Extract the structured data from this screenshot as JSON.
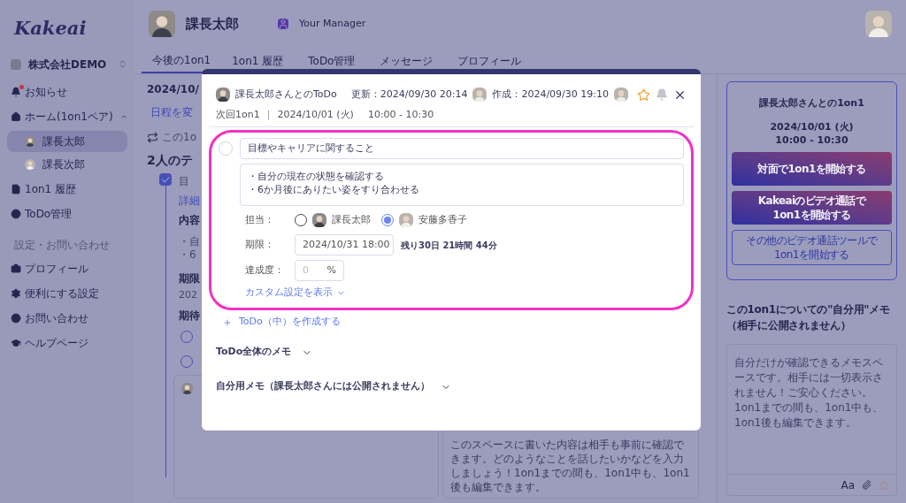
{
  "app": {
    "logo": "Kakeai",
    "company": "株式会社DEMO"
  },
  "sidebar": {
    "items": [
      {
        "kind": "link",
        "label": "お知らせ",
        "unread": true
      },
      {
        "kind": "group",
        "label": "ホーム(1on1ペア)",
        "expanded": true,
        "children": [
          {
            "label": "課長太郎",
            "selected": true
          },
          {
            "label": "課長次郎",
            "selected": false
          }
        ]
      },
      {
        "kind": "link",
        "label": "1on1 履歴",
        "unread": false
      },
      {
        "kind": "link",
        "label": "ToDo管理",
        "unread": false
      },
      {
        "kind": "heading",
        "label": "設定・お問い合わせ"
      },
      {
        "kind": "link",
        "label": "プロフィール",
        "unread": false
      },
      {
        "kind": "link",
        "label": "便利にする設定",
        "unread": false
      },
      {
        "kind": "link",
        "label": "お問い合わせ",
        "unread": false
      },
      {
        "kind": "link",
        "label": "ヘルプページ",
        "unread": false
      }
    ]
  },
  "header": {
    "name": "課長太郎",
    "role": "Your Manager"
  },
  "tabs": [
    {
      "label": "今後の1on1",
      "selected": true
    },
    {
      "label": "1on1 履歴",
      "selected": false
    },
    {
      "label": "ToDo管理",
      "selected": false
    },
    {
      "label": "メッセージ",
      "selected": false
    },
    {
      "label": "プロフィール",
      "selected": false
    }
  ],
  "main": {
    "date": "2024/10/",
    "reschedule": "日程を変",
    "repeat": "この1o",
    "themes_heading": "2人のテ",
    "theme": {
      "checked": true,
      "title": "目",
      "detail_link": "詳細",
      "content_label": "内容",
      "lines": [
        "・自",
        "・6"
      ],
      "due_label": "期限",
      "due": "202",
      "expect_label": "期待"
    },
    "shared_memo_hint": "このスペースに書いた内容は相手も事前に確認できます。どのようなことを話したいかなどを入力しましょう！1on1までの間も、1on1中も、1on1後も編集できます。"
  },
  "right_panel": {
    "title": "課長太郎さんとの1on1",
    "date": "2024/10/01 (火)",
    "time": "10:00 - 10:30",
    "buttons": [
      {
        "kind": "primary",
        "lines": [
          "対面で1on1を開始する"
        ]
      },
      {
        "kind": "primary",
        "lines": [
          "Kakeaiのビデオ通話で",
          "1on1を開始する"
        ]
      },
      {
        "kind": "outline",
        "lines": [
          "その他のビデオ通話ツールで",
          "1on1を開始する"
        ]
      }
    ],
    "memo_heading": [
      "この1on1についての\"自分用\"メモ",
      "（相手に公開されません）"
    ],
    "memo_placeholder": "自分だけが確認できるメモスペースです。相手には一切表示されません！ご安心ください。1on1までの間も、1on1中も、1on1後も編集できます。",
    "format_label": "Aa"
  },
  "modal": {
    "title": "課長太郎さんとのToDo",
    "updated": "更新：2024/09/30 20:14",
    "created": "作成：2024/09/30 19:10",
    "starred": false,
    "notify": false,
    "next_label": "次回1on1",
    "separator": "|",
    "next_date": "2024/10/01 (火)",
    "next_time": "10:00 - 10:30",
    "todo": {
      "done": false,
      "title": "目標やキャリアに関すること",
      "body_lines": [
        "・自分の現在の状態を確認する",
        "・6か月後にありたい姿をすり合わせる"
      ],
      "assignee_label": "担当：",
      "assignees": [
        {
          "name": "課長太郎",
          "selected": false
        },
        {
          "name": "安藤多香子",
          "selected": true
        }
      ],
      "due_label": "期限：",
      "due": "2024/10/31 18:00",
      "remaining": "残り30日 21時間 44分",
      "progress_label": "達成度：",
      "progress_placeholder": "0",
      "progress_unit": "%",
      "custom_link": "カスタム設定を表示"
    },
    "add_link": "ToDo（中）を作成する",
    "sections": [
      {
        "label": "ToDo全体のメモ",
        "expanded": false
      },
      {
        "label": "自分用メモ（課長太郎さんには公開されません）",
        "expanded": false
      }
    ]
  }
}
